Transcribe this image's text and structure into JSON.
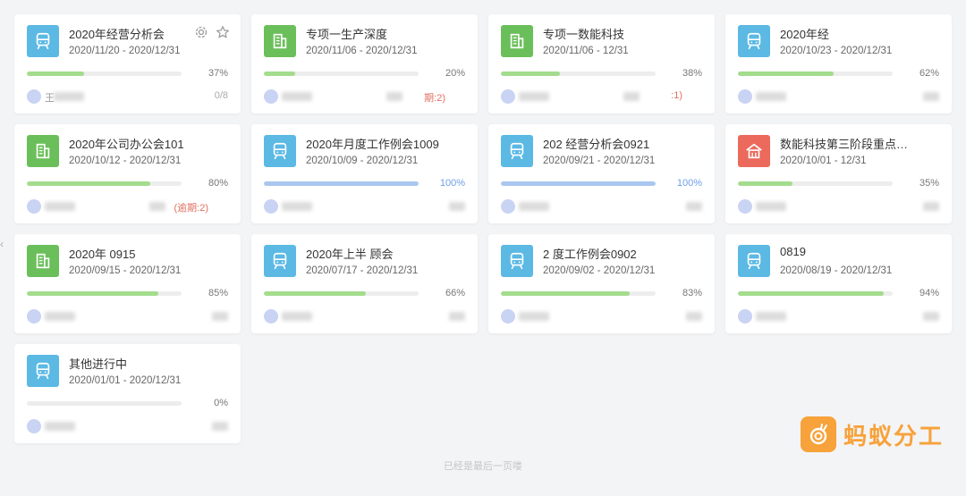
{
  "colors": {
    "tram_icon": "#5bb9e4",
    "building_icon": "#6bbf5a",
    "house_icon": "#ec6a5c",
    "progress_green": "#a3dc8d",
    "progress_blue": "#a9c7f0",
    "overdue": "#e07062",
    "brand": "#f7a23a"
  },
  "cards": [
    {
      "icon": "tram-icon",
      "title": "2020年经营分析会",
      "date": "2020/11/20 - 2020/12/31",
      "progress": 37,
      "pct": "37%",
      "owner": "王",
      "count": "0/8",
      "overdue": "",
      "actions": true
    },
    {
      "icon": "building-icon",
      "title": "专项一生产深度",
      "date": "2020/11/06 - 2020/12/31",
      "progress": 20,
      "pct": "20%",
      "owner": "",
      "count": "",
      "overdue": "期:2)",
      "actions": false
    },
    {
      "icon": "building-icon",
      "title": "专项一数能科技",
      "date": "2020/11/06 - 12/31",
      "progress": 38,
      "pct": "38%",
      "owner": "",
      "count": "",
      "overdue": ":1)",
      "actions": false
    },
    {
      "icon": "tram-icon",
      "title": "2020年经",
      "date": "2020/10/23 - 2020/12/31",
      "progress": 62,
      "pct": "62%",
      "owner": "",
      "count": "",
      "overdue": "",
      "actions": false
    },
    {
      "icon": "building-icon",
      "title": "2020年公司办公会101",
      "date": "2020/10/12 - 2020/12/31",
      "progress": 80,
      "pct": "80%",
      "owner": "",
      "count": "",
      "overdue": "(逾期:2)",
      "actions": false
    },
    {
      "icon": "tram-icon",
      "title": "2020年月度工作例会1009",
      "date": "2020/10/09 - 2020/12/31",
      "progress": 100,
      "pct": "100%",
      "owner": "",
      "count": "",
      "overdue": "",
      "actions": false
    },
    {
      "icon": "tram-icon",
      "title": "202 经营分析会0921",
      "date": "2020/09/21 - 2020/12/31",
      "progress": 100,
      "pct": "100%",
      "owner": "",
      "count": "",
      "overdue": "",
      "actions": false
    },
    {
      "icon": "house-icon",
      "title": "数能科技第三阶段重点工作",
      "date": "2020/10/01 - 12/31",
      "progress": 35,
      "pct": "35%",
      "owner": "",
      "count": "",
      "overdue": "",
      "actions": false
    },
    {
      "icon": "building-icon",
      "title": "2020年 0915",
      "date": "2020/09/15 - 2020/12/31",
      "progress": 85,
      "pct": "85%",
      "owner": "",
      "count": "",
      "overdue": "",
      "actions": false
    },
    {
      "icon": "tram-icon",
      "title": "2020年上半 顾会",
      "date": "2020/07/17 - 2020/12/31",
      "progress": 66,
      "pct": "66%",
      "owner": "",
      "count": "",
      "overdue": "",
      "actions": false
    },
    {
      "icon": "tram-icon",
      "title": "2 度工作例会0902",
      "date": "2020/09/02 - 2020/12/31",
      "progress": 83,
      "pct": "83%",
      "owner": "",
      "count": "",
      "overdue": "",
      "actions": false
    },
    {
      "icon": "tram-icon",
      "title": "0819",
      "date": "2020/08/19 - 2020/12/31",
      "progress": 94,
      "pct": "94%",
      "owner": "",
      "count": "",
      "overdue": "",
      "actions": false
    },
    {
      "icon": "tram-icon",
      "title": "其他进行中",
      "date": "2020/01/01 - 2020/12/31",
      "progress": 0,
      "pct": "0%",
      "owner": "",
      "count": "",
      "overdue": "",
      "actions": false
    }
  ],
  "footer_text": "已经是最后一页喽",
  "brand": {
    "name": "蚂蚁分工",
    "logo": "snail-logo-icon"
  },
  "nav": {
    "left_arrow": "‹"
  }
}
